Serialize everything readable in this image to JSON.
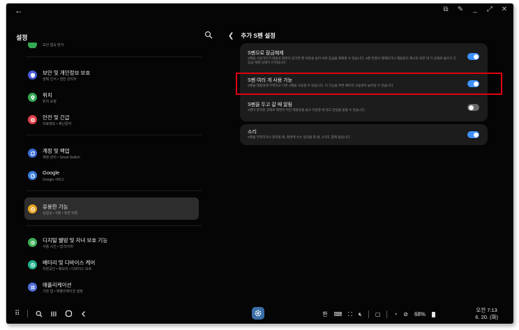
{
  "left_panel": {
    "title": "설정",
    "cut_item_sub": "보안 접속 방식",
    "items": [
      {
        "title": "보안 및 개인정보 보호",
        "sub": "생체 인식 • 권한 관리자",
        "color": "#4a5bd6"
      },
      {
        "title": "위치",
        "sub": "위치 요청",
        "color": "#33a852"
      },
      {
        "title": "안전 및 긴급",
        "sub": "의료정보 • 재난문자",
        "color": "#e0434b"
      },
      {
        "title": "계정 및 백업",
        "sub": "계정 관리 • Smart Switch",
        "color": "#3d6fd6"
      },
      {
        "title": "Google",
        "sub": "Google 서비스",
        "color": "#3b7ddc"
      },
      {
        "title": "유용한 기능",
        "sub": "실험실 • S펜 • 측면 버튼",
        "color": "#e8a623"
      },
      {
        "title": "디지털 웰빙 및 자녀 보호 기능",
        "sub": "사용 시간 • 앱 타이머",
        "color": "#3fae57"
      },
      {
        "title": "배터리 및 디바이스 케어",
        "sub": "저장공간 • 메모리 • 디바이스 보호",
        "color": "#20b28a"
      },
      {
        "title": "애플리케이션",
        "sub": "기본 앱 • 애플리케이션 설정",
        "color": "#4f6fd9"
      }
    ]
  },
  "right_panel": {
    "title": "추가 S펜 설정",
    "settings": [
      {
        "title": "S펜으로 잠금해제",
        "desc": "S펜을 사용하다가 태블릿 화면이 잠기면 펜 버튼을 눌러 바로 잠금을 해제할 수 있습니다. S펜 연결이 해제되거나 태블릿이 재시작 되면 대 기 상태로 들어가 진 잠금 해제 상태가 유지됩니다.",
        "on": true
      },
      {
        "title": "S펜 여러 개 사용 가능",
        "desc": "S펜을 태블릿에 부착하고 다른 S펜을 사용할 수 있습니다. 이 기능을 켜면 배터리 사용량이 늘어날 수 있습니다.",
        "on": true
      },
      {
        "title": "S펜을 두고 갈 때 알림",
        "desc": "S펜이 분리된 상태로 화면이 꺼진 태블릿을 들고 이동할 때 경고 알림을 받을 수 있습니다.",
        "on": false
      },
      {
        "title": "소리",
        "desc": "S펜을 부착하거나 분리할 때, 화면에 쓰는 동작을 할 때, 소리도 함께 들립니다.",
        "on": true
      }
    ]
  },
  "taskbar": {
    "ime": "한",
    "battery": "68%",
    "time": "오전 7:13",
    "date": "6. 20. (화)"
  },
  "colors": {
    "accent_blue": "#3e91ff",
    "highlight_red": "#e3000f"
  }
}
